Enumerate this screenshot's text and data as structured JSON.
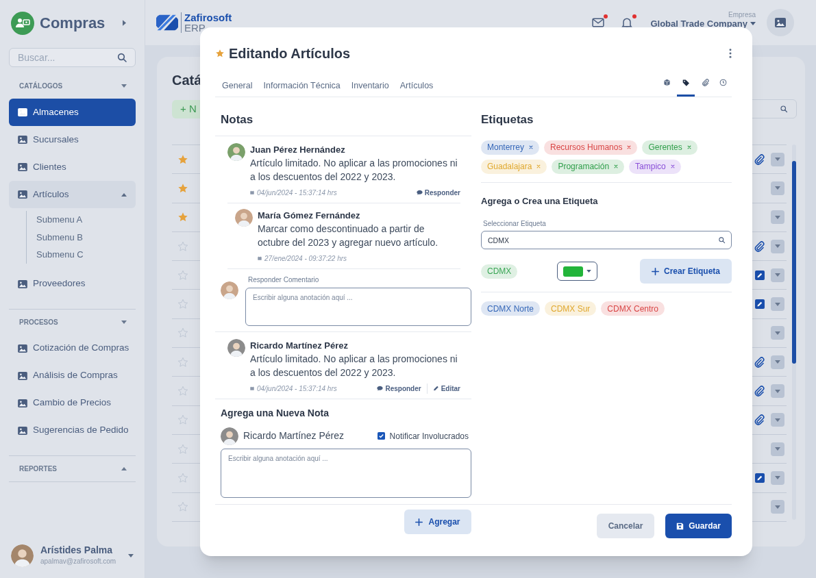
{
  "sidebar": {
    "module": "Compras",
    "search": {
      "placeholder": "Buscar..."
    },
    "sections": [
      {
        "title": "CATÁLOGOS",
        "expanded": true,
        "items": [
          {
            "label": "Almacenes",
            "selected": true,
            "expanded": false
          },
          {
            "label": "Sucursales",
            "selected": false,
            "expanded": false
          },
          {
            "label": "Clientes",
            "selected": false,
            "expanded": false
          },
          {
            "label": "Artículos",
            "selected": false,
            "expanded": true,
            "children": [
              {
                "label": "Submenu A",
                "selected": false
              },
              {
                "label": "Submenu B",
                "selected": false
              },
              {
                "label": "Submenu C",
                "selected": false
              }
            ]
          },
          {
            "label": "Proveedores",
            "selected": false,
            "expanded": false
          }
        ]
      },
      {
        "title": "PROCESOS",
        "expanded": true,
        "items": [
          {
            "label": "Cotización de Compras",
            "selected": false,
            "expanded": false
          },
          {
            "label": "Análisis de Compras",
            "selected": false,
            "expanded": false
          },
          {
            "label": "Cambio de Precios",
            "selected": false,
            "expanded": false
          },
          {
            "label": "Sugerencias de Pedido",
            "selected": false,
            "expanded": false
          }
        ]
      },
      {
        "title": "REPORTES",
        "expanded": false
      }
    ],
    "user": {
      "name": "Arístides Palma",
      "email": "apalmav@zafirosoft.com"
    }
  },
  "header": {
    "brand": "Zafirosoft",
    "product": "ERP",
    "alerts": [
      {
        "kind": "mail",
        "unread": true
      },
      {
        "kind": "bell",
        "unread": true
      }
    ],
    "company_label": "Empresa",
    "company": "Global Trade Company"
  },
  "page": {
    "title": "Catá",
    "new_button": "+ N",
    "rows": [
      {
        "starred": true,
        "kind": "clip"
      },
      {
        "starred": true,
        "kind": "plain"
      },
      {
        "starred": true,
        "kind": "plain"
      },
      {
        "starred": false,
        "kind": "clip"
      },
      {
        "starred": false,
        "kind": "edit"
      },
      {
        "starred": false,
        "kind": "edit"
      },
      {
        "starred": false,
        "kind": "plain"
      },
      {
        "starred": false,
        "kind": "clip"
      },
      {
        "starred": false,
        "kind": "clip"
      },
      {
        "starred": false,
        "kind": "clip"
      },
      {
        "starred": false,
        "kind": "plain"
      },
      {
        "starred": false,
        "kind": "edit"
      },
      {
        "starred": false,
        "kind": "plain"
      }
    ]
  },
  "modal": {
    "title": "Editando Artículos",
    "favorite": true,
    "tabs": [
      {
        "label": "General",
        "selected": false
      },
      {
        "label": "Información Técnica",
        "selected": false
      },
      {
        "label": "Inventario",
        "selected": false
      },
      {
        "label": "Artículos",
        "selected": false
      }
    ],
    "icon_tabs": [
      {
        "kind": "box",
        "selected": false
      },
      {
        "kind": "tag",
        "selected": true
      },
      {
        "kind": "clip",
        "selected": false
      },
      {
        "kind": "clock",
        "selected": false
      }
    ],
    "notes": {
      "title": "Notas",
      "items": [
        {
          "author": "Juan Pérez Hernández",
          "text": "Artículo limitado. No aplicar a las promociones ni a los descuentos del 2022 y 2023.",
          "date": "04/jun/2024 - 15:37:14 hrs",
          "actions": [
            {
              "kind": "reply",
              "label": "Responder"
            }
          ],
          "replies": [
            {
              "author": "María Gómez Fernández",
              "text": "Marcar como descontinuado a partir de octubre del 2023 y agregar nuevo artículo.",
              "date": "27/ene/2024 - 09:37:22 hrs"
            }
          ],
          "reply_field": {
            "label": "Responder Comentario",
            "placeholder": "Escribir alguna anotación aquí ..."
          }
        },
        {
          "author": "Ricardo Martínez Pérez",
          "text": "Artículo limitado. No aplicar a las promociones ni a los descuentos del 2022 y 2023.",
          "date": "04/jun/2024 - 15:37:14 hrs",
          "actions": [
            {
              "kind": "reply",
              "label": "Responder"
            },
            {
              "kind": "edit",
              "label": "Editar"
            }
          ]
        }
      ]
    },
    "new_note": {
      "title": "Agrega una Nueva Nota",
      "author": "Ricardo Martínez Pérez",
      "notify": {
        "label": "Notificar Involucrados",
        "checked": true
      },
      "placeholder": "Escribir alguna anotación aquí ...",
      "button": "Agregar"
    },
    "tags": {
      "title": "Etiquetas",
      "items": [
        {
          "label": "Monterrey",
          "color": "#3567b8"
        },
        {
          "label": "Recursos Humanos",
          "color": "#d94545"
        },
        {
          "label": "Gerentes",
          "color": "#2f9e4a"
        },
        {
          "label": "Guadalajara",
          "color": "#e0a82e"
        },
        {
          "label": "Programación",
          "color": "#2f9e4a"
        },
        {
          "label": "Tampico",
          "color": "#8a4fd8"
        }
      ]
    },
    "tag_creator": {
      "title": "Agrega o Crea una Etiqueta",
      "field_label": "Seleccionar Etiqueta",
      "value": "CDMX",
      "preview": {
        "label": "CDMX",
        "color": "#3aa655"
      },
      "swatch": {
        "color": "#22b43a"
      },
      "button": "Crear Etiqueta",
      "suggestions": [
        {
          "label": "CDMX Norte",
          "color": "#3567b8"
        },
        {
          "label": "CDMX Sur",
          "color": "#e0a82e"
        },
        {
          "label": "CDMX Centro",
          "color": "#d94545"
        }
      ]
    },
    "footer": {
      "cancel": "Cancelar",
      "save": "Guardar"
    }
  }
}
